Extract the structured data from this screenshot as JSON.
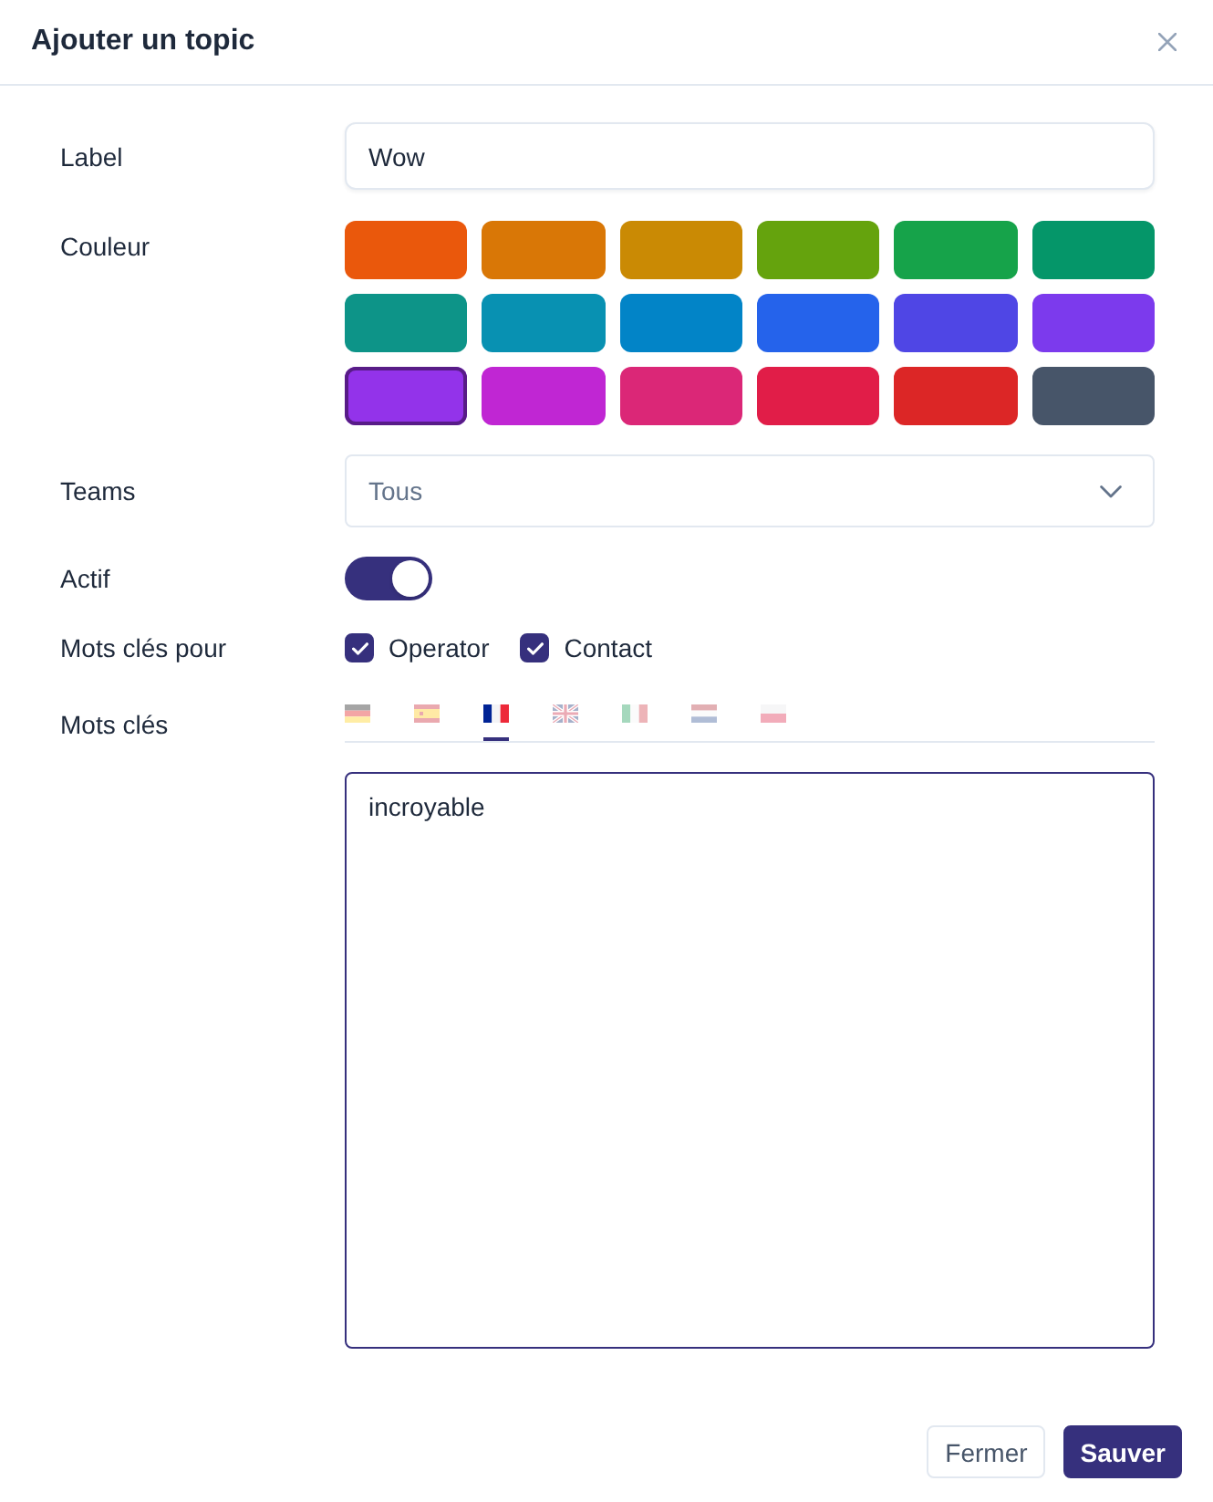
{
  "dialog": {
    "title": "Ajouter un topic"
  },
  "form": {
    "label": {
      "label": "Label",
      "value": "Wow"
    },
    "color": {
      "label": "Couleur",
      "swatches": [
        {
          "color": "#ea580c",
          "selected": false
        },
        {
          "color": "#d97706",
          "selected": false
        },
        {
          "color": "#ca8a04",
          "selected": false
        },
        {
          "color": "#65a30d",
          "selected": false
        },
        {
          "color": "#16a34a",
          "selected": false
        },
        {
          "color": "#059669",
          "selected": false
        },
        {
          "color": "#0d9488",
          "selected": false
        },
        {
          "color": "#0891b2",
          "selected": false
        },
        {
          "color": "#0284c7",
          "selected": false
        },
        {
          "color": "#2563eb",
          "selected": false
        },
        {
          "color": "#4f46e5",
          "selected": false
        },
        {
          "color": "#7c3aed",
          "selected": false
        },
        {
          "color": "#9333ea",
          "selected": true
        },
        {
          "color": "#c026d3",
          "selected": false
        },
        {
          "color": "#db2777",
          "selected": false
        },
        {
          "color": "#e11d48",
          "selected": false
        },
        {
          "color": "#dc2626",
          "selected": false
        },
        {
          "color": "#475569",
          "selected": false
        }
      ]
    },
    "teams": {
      "label": "Teams",
      "value": "Tous"
    },
    "active": {
      "label": "Actif",
      "on": true
    },
    "keywords_for": {
      "label": "Mots clés pour",
      "options": [
        {
          "label": "Operator",
          "checked": true
        },
        {
          "label": "Contact",
          "checked": true
        }
      ]
    },
    "keywords": {
      "label": "Mots clés",
      "language_tabs": [
        {
          "kind": "de",
          "selected": false
        },
        {
          "kind": "es",
          "selected": false
        },
        {
          "kind": "fr",
          "selected": true
        },
        {
          "kind": "gb",
          "selected": false
        },
        {
          "kind": "it",
          "selected": false
        },
        {
          "kind": "nl",
          "selected": false
        },
        {
          "kind": "pl",
          "selected": false
        }
      ],
      "text": "incroyable",
      "focused": true
    }
  },
  "buttons": [
    {
      "label": "Fermer",
      "kind": "secondary"
    },
    {
      "label": "Sauver",
      "kind": "primary"
    }
  ]
}
